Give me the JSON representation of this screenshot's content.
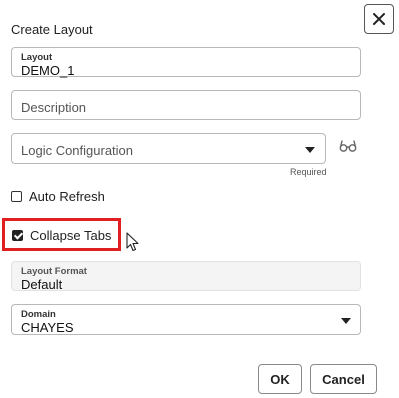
{
  "dialog": {
    "title": "Create Layout",
    "close_icon": "close-icon"
  },
  "fields": {
    "layout": {
      "label": "Layout",
      "value": "DEMO_1"
    },
    "description": {
      "placeholder": "Description"
    },
    "logic_configuration": {
      "placeholder": "Logic Configuration",
      "helper": "Required",
      "icon": "glasses-icon"
    },
    "layout_format": {
      "label": "Layout Format",
      "value": "Default"
    },
    "domain": {
      "label": "Domain",
      "value": "CHAYES"
    }
  },
  "checkboxes": {
    "auto_refresh": {
      "label": "Auto Refresh",
      "checked": false
    },
    "collapse_tabs": {
      "label": "Collapse Tabs",
      "checked": true
    }
  },
  "buttons": {
    "ok": "OK",
    "cancel": "Cancel"
  },
  "colors": {
    "highlight": "#e02020",
    "border": "#b8b8b8"
  }
}
